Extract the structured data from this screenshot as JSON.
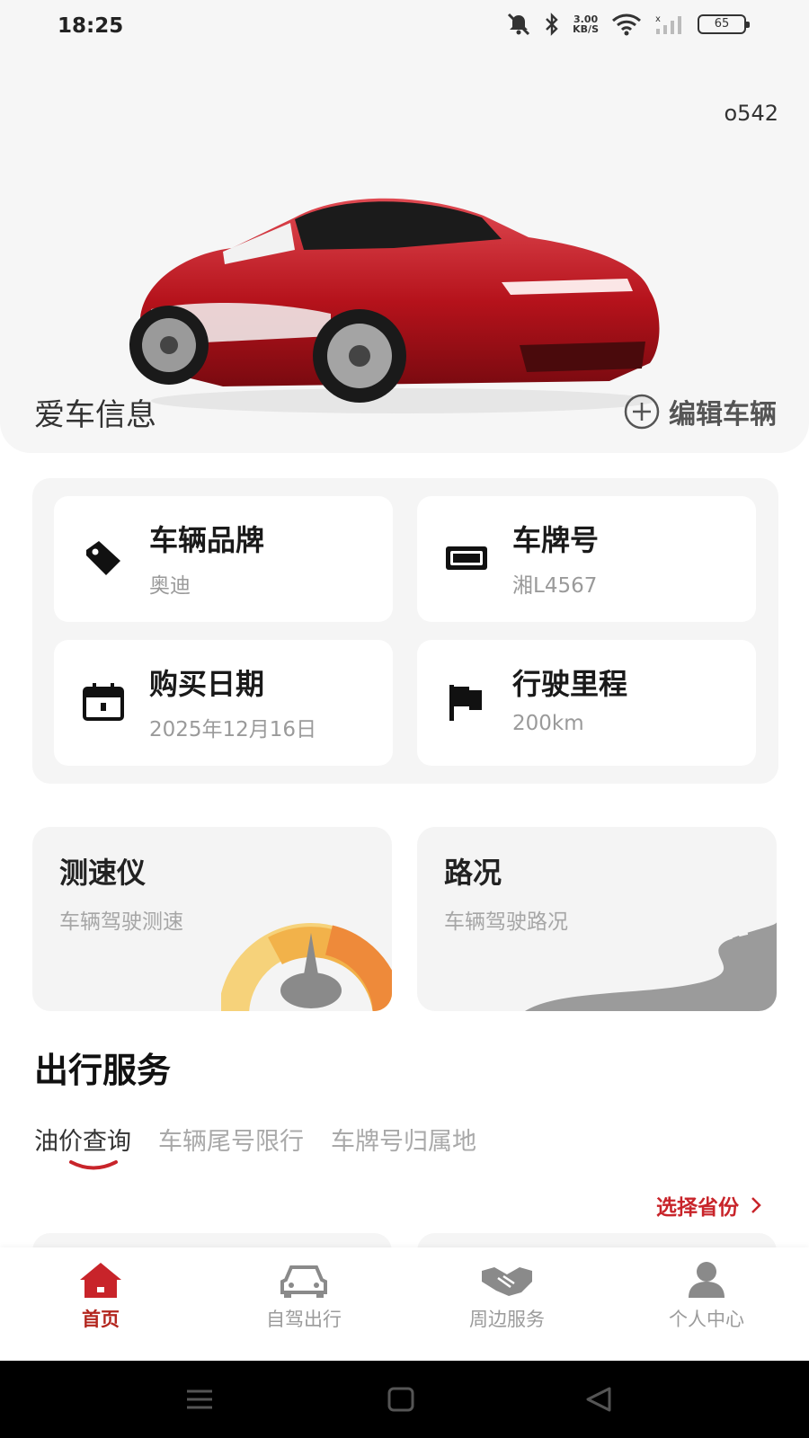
{
  "status_bar": {
    "time": "18:25",
    "net_speed_value": "3.00",
    "net_speed_unit": "KB/S",
    "battery": "65"
  },
  "hero": {
    "code": "o542",
    "title": "爱车信息",
    "edit_label": "编辑车辆"
  },
  "vehicle_info": [
    {
      "label": "车辆品牌",
      "value": "奥迪",
      "icon": "tag-icon"
    },
    {
      "label": "车牌号",
      "value": "湘L4567",
      "icon": "license-plate-icon"
    },
    {
      "label": "购买日期",
      "value": "2025年12月16日",
      "icon": "calendar-icon"
    },
    {
      "label": "行驶里程",
      "value": "200km",
      "icon": "flag-icon"
    }
  ],
  "tools": [
    {
      "title": "测速仪",
      "subtitle": "车辆驾驶测速",
      "icon": "speedometer-icon"
    },
    {
      "title": "路况",
      "subtitle": "车辆驾驶路况",
      "icon": "road-icon"
    }
  ],
  "services": {
    "title": "出行服务",
    "tabs": [
      "油价查询",
      "车辆尾号限行",
      "车牌号归属地"
    ],
    "active_tab": 0,
    "choose_province": "选择省份"
  },
  "tabbar": [
    {
      "label": "首页",
      "icon": "home-icon",
      "active": true
    },
    {
      "label": "自驾出行",
      "icon": "car-icon",
      "active": false
    },
    {
      "label": "周边服务",
      "icon": "handshake-icon",
      "active": false
    },
    {
      "label": "个人中心",
      "icon": "person-icon",
      "active": false
    }
  ],
  "colors": {
    "accent": "#c8242a",
    "panel_bg": "#f5f5f5"
  }
}
